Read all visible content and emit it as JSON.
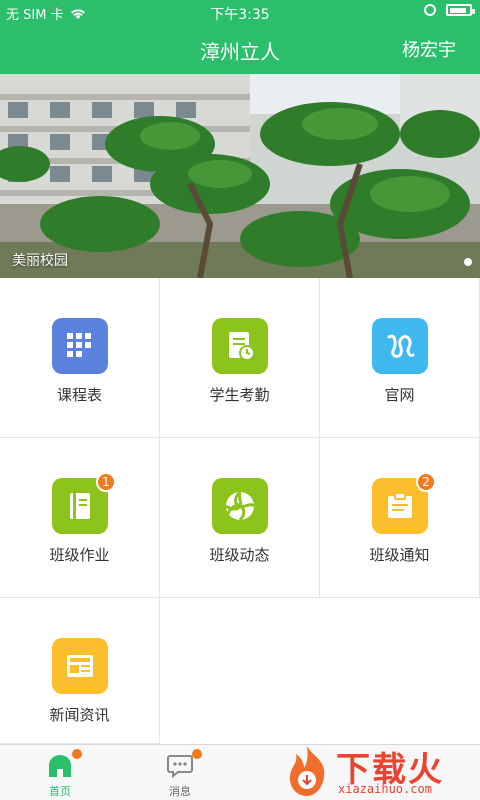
{
  "status_bar": {
    "carrier": "无 SIM 卡",
    "time": "下午3:35",
    "battery_level": 0.9
  },
  "nav": {
    "title": "漳州立人",
    "user": "杨宏宇"
  },
  "banner": {
    "caption": "美丽校园"
  },
  "grid": {
    "items": [
      {
        "label": "课程表",
        "icon": "schedule-icon",
        "color": "#5b82dc",
        "badge": ""
      },
      {
        "label": "学生考勤",
        "icon": "attendance-icon",
        "color": "#8cc41b",
        "badge": ""
      },
      {
        "label": "官网",
        "icon": "website-icon",
        "color": "#3fb8ee",
        "badge": ""
      },
      {
        "label": "班级作业",
        "icon": "homework-icon",
        "color": "#8cc41b",
        "badge": "1"
      },
      {
        "label": "班级动态",
        "icon": "class-news-icon",
        "color": "#8cc41b",
        "badge": ""
      },
      {
        "label": "班级通知",
        "icon": "notice-icon",
        "color": "#fbbf2e",
        "badge": "2"
      },
      {
        "label": "新闻资讯",
        "icon": "news-icon",
        "color": "#fbbf2e",
        "badge": ""
      }
    ]
  },
  "tabbar": {
    "home_label": "首页",
    "messages_label": "消息",
    "active_color": "#2bbf6b"
  },
  "watermark": {
    "brand": "下载火",
    "url": "xiazaihuo.com"
  }
}
